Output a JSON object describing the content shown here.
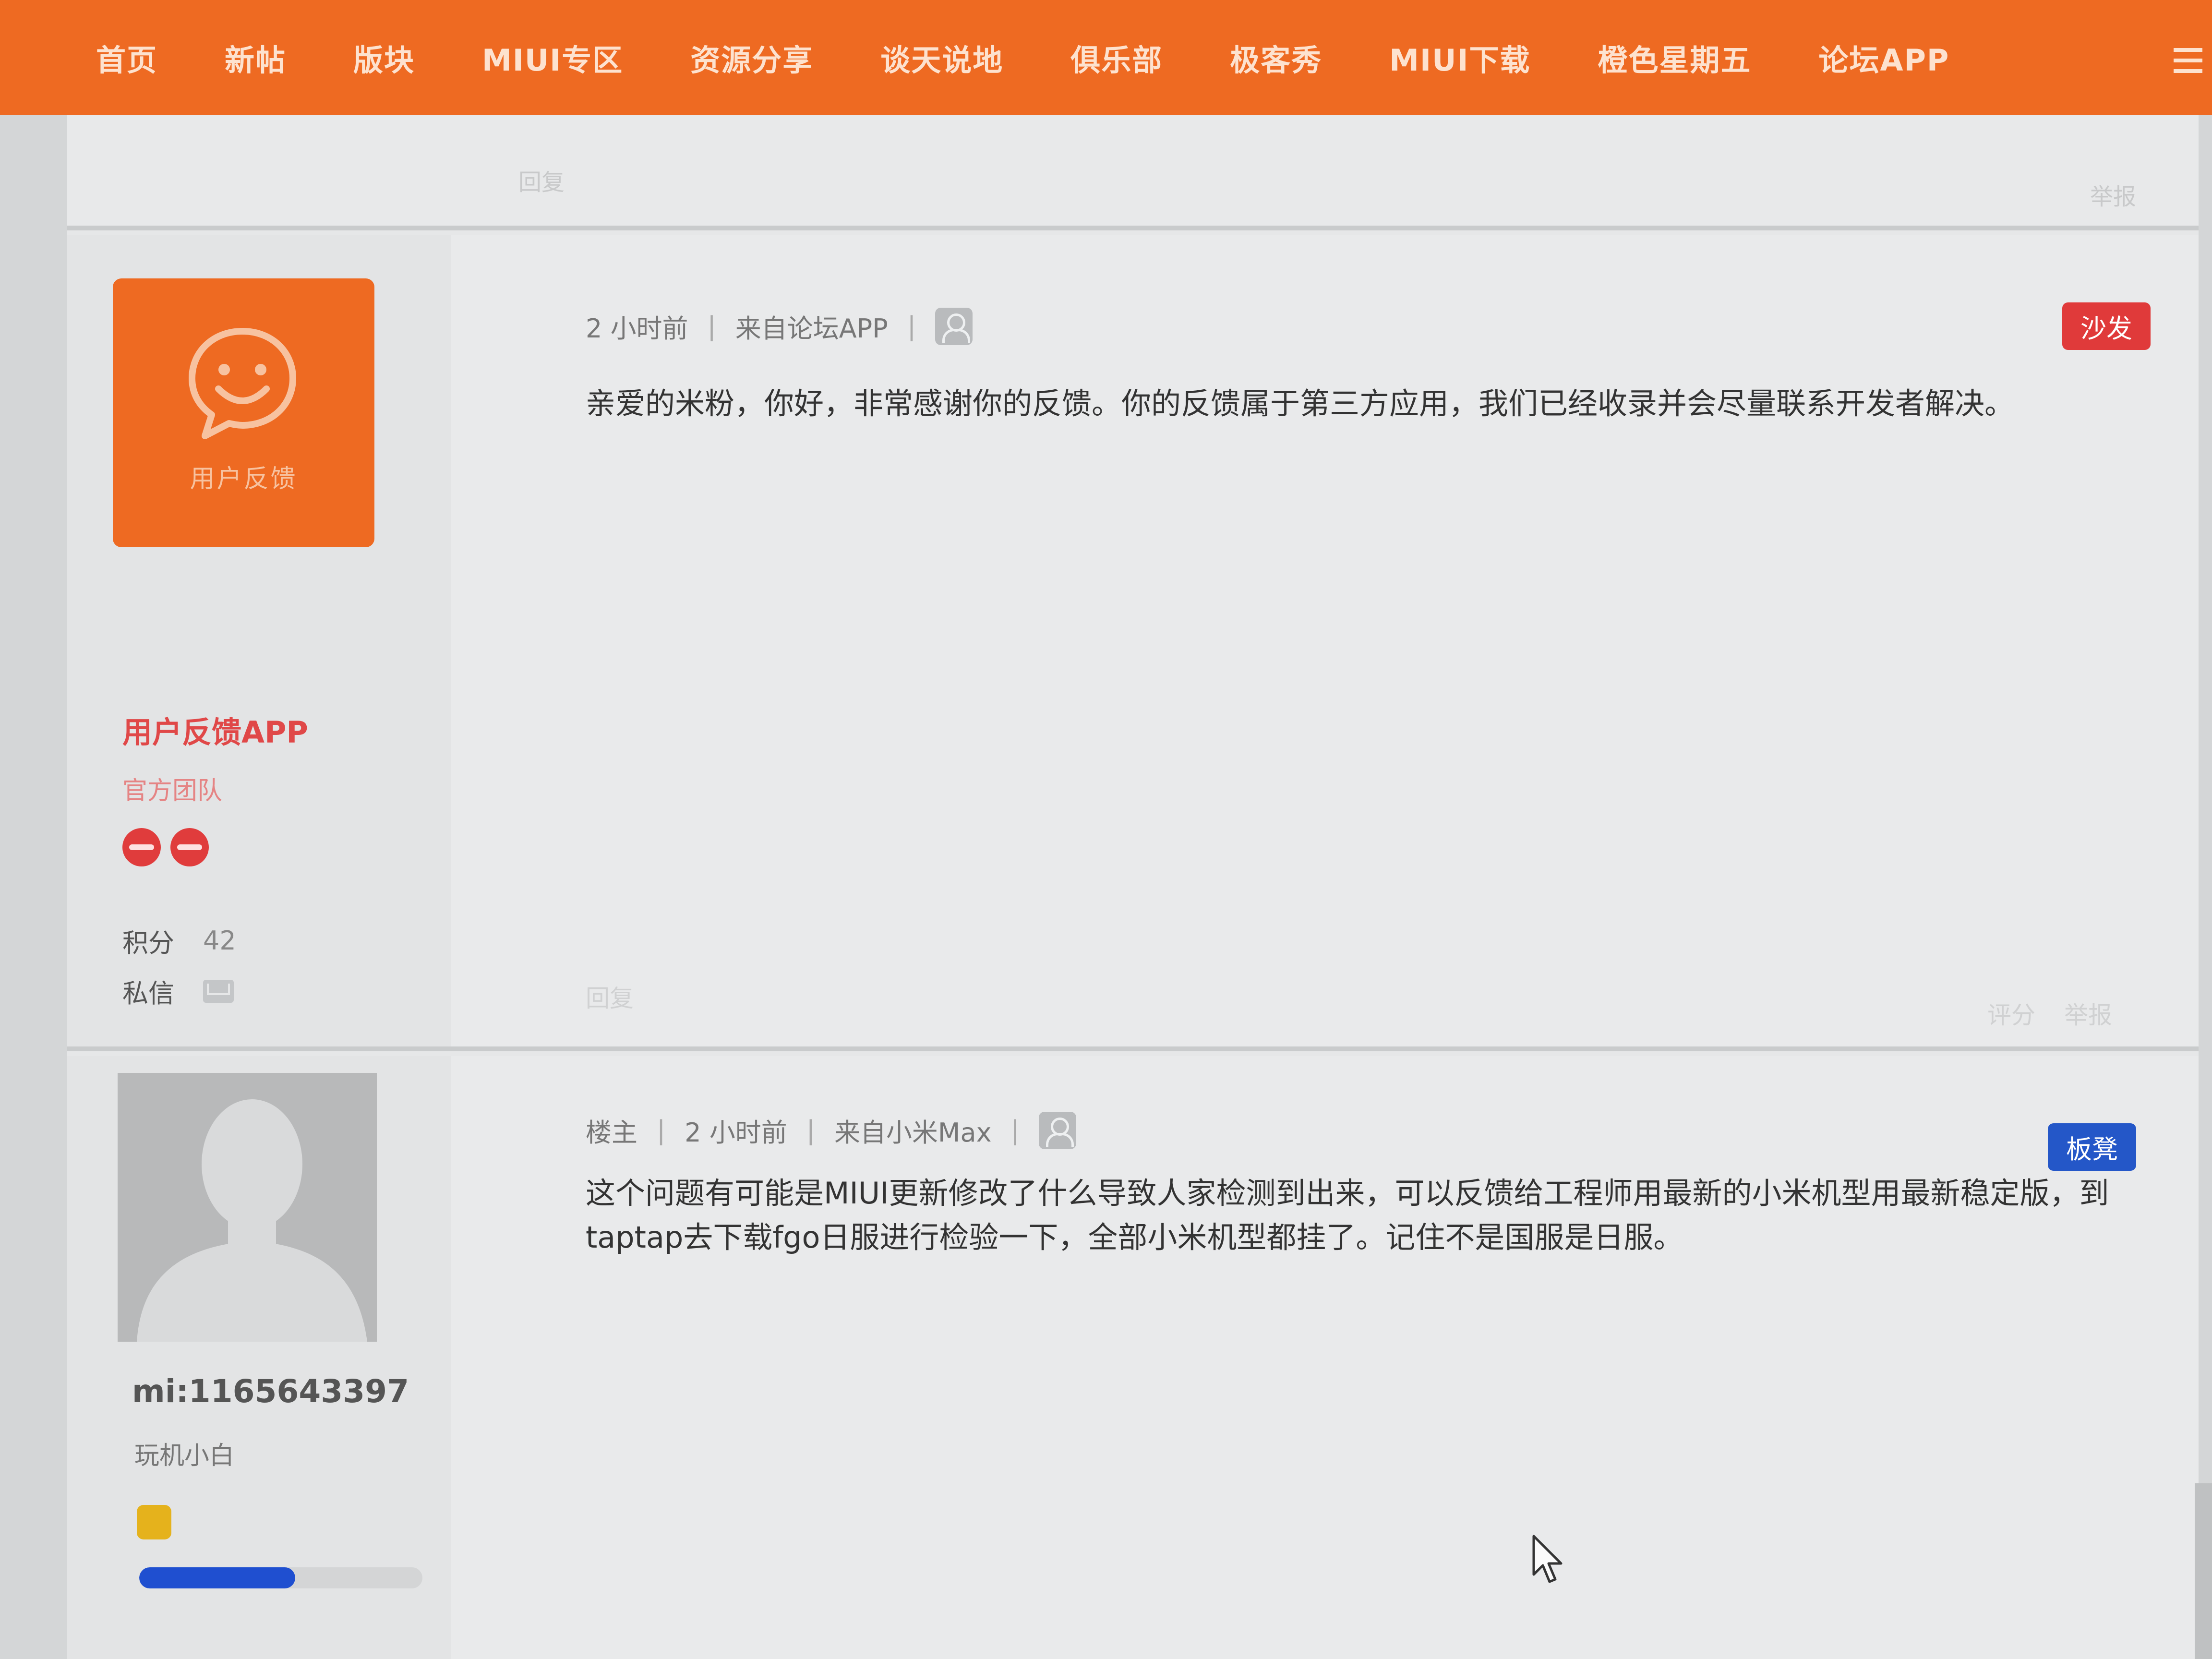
{
  "nav": {
    "items": [
      "首页",
      "新帖",
      "版块",
      "MIUI专区",
      "资源分享",
      "谈天说地",
      "俱乐部",
      "极客秀",
      "MIUI下载",
      "橙色星期五",
      "论坛APP"
    ]
  },
  "prev_post": {
    "reply_label": "回复",
    "report_label": "举报"
  },
  "posts": [
    {
      "author": {
        "avatar_label": "用户反馈",
        "name": "用户反馈APP",
        "group": "官方团队",
        "points_label": "积分",
        "points_value": "42",
        "message_label": "私信"
      },
      "meta": {
        "time": "2 小时前",
        "source": "来自论坛APP"
      },
      "floor_tag": "沙发",
      "text": "亲爱的米粉，你好，非常感谢你的反馈。你的反馈属于第三方应用，我们已经收录并会尽量联系开发者解决。",
      "reply_label": "回复",
      "rate_label": "评分",
      "report_label": "举报"
    },
    {
      "author": {
        "name": "mi:1165643397",
        "group": "玩机小白",
        "level_progress": 0.55
      },
      "meta": {
        "owner_tag": "楼主",
        "time": "2 小时前",
        "source": "来自小米Max"
      },
      "floor_tag": "板凳",
      "text": "这个问题有可能是MIUI更新修改了什么导致人家检测到出来，可以反馈给工程师用最新的小米机型用最新稳定版，到taptap去下载fgo日服进行检验一下，全部小米机型都挂了。记住不是国服是日服。"
    }
  ],
  "colors": {
    "brand_orange": "#ee6a22",
    "sofa_red": "#e03a3a",
    "bench_blue": "#2457c8",
    "progress_blue": "#1f4fd0"
  },
  "icons": {
    "menu": "menu-icon",
    "user_device": "user-icon",
    "mail": "mail-icon",
    "cursor": "cursor-icon"
  }
}
